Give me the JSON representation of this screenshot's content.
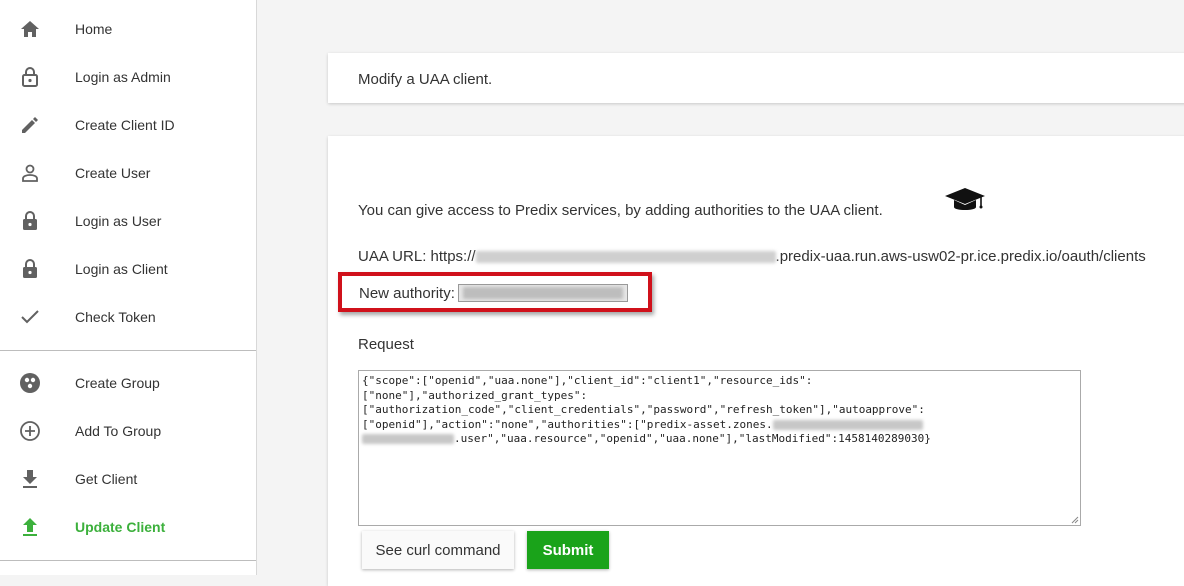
{
  "sidebar": {
    "items": [
      {
        "label": "Home",
        "icon": "home-icon"
      },
      {
        "label": "Login as Admin",
        "icon": "lock-open-icon"
      },
      {
        "label": "Create Client ID",
        "icon": "pencil-icon"
      },
      {
        "label": "Create User",
        "icon": "person-icon"
      },
      {
        "label": "Login as User",
        "icon": "lock-icon"
      },
      {
        "label": "Login as Client",
        "icon": "lock-icon"
      },
      {
        "label": "Check Token",
        "icon": "check-icon"
      },
      {
        "label": "Create Group",
        "icon": "group-icon"
      },
      {
        "label": "Add To Group",
        "icon": "add-circle-icon"
      },
      {
        "label": "Get Client",
        "icon": "download-icon"
      },
      {
        "label": "Update Client",
        "icon": "upload-icon",
        "active": true
      }
    ]
  },
  "main": {
    "title": "Modify a UAA client.",
    "intro": "You can give access to Predix services, by adding authorities to the UAA client.",
    "uaa_url_label": "UAA URL: https://",
    "uaa_url_suffix": ".predix-uaa.run.aws-usw02-pr.ice.predix.io/oauth/clients",
    "new_authority_label": "New authority:",
    "request_label": "Request",
    "request_body_part1": "{\"scope\":[\"openid\",\"uaa.none\"],\"client_id\":\"client1\",\"resource_ids\":\n[\"none\"],\"authorized_grant_types\":\n[\"authorization_code\",\"client_credentials\",\"password\",\"refresh_token\"],\"autoapprove\":\n[\"openid\"],\"action\":\"none\",\"authorities\":[\"predix-asset.zones.",
    "request_body_part2": ".user\",\"uaa.resource\",\"openid\",\"uaa.none\"],\"lastModified\":1458140289030}",
    "curl_button": "See curl command",
    "submit_button": "Submit"
  },
  "colors": {
    "accent_green": "#3cb03c",
    "submit_green": "#1aa31a",
    "highlight_red": "#d0111b"
  }
}
